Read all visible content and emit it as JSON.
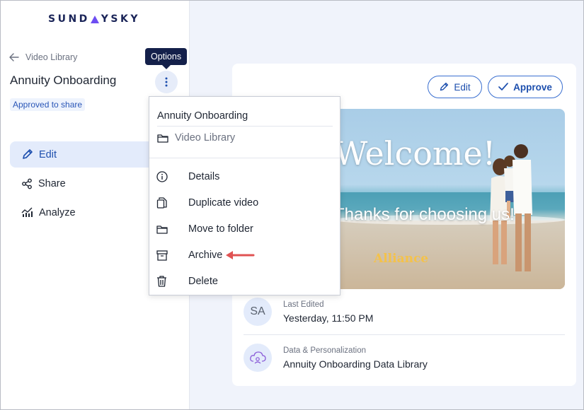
{
  "brand": {
    "logo_text_before": "SUND",
    "logo_text_after": "YSKY"
  },
  "sidebar": {
    "back_label": "Video Library",
    "video_title": "Annuity Onboarding",
    "tooltip": "Options",
    "status_badge": "Approved to share",
    "nav": [
      {
        "label": "Edit",
        "icon": "pencil-icon",
        "active": true
      },
      {
        "label": "Share",
        "icon": "share-icon",
        "active": false
      },
      {
        "label": "Analyze",
        "icon": "analyze-chart-icon",
        "active": false
      }
    ]
  },
  "menu": {
    "title": "Annuity Onboarding",
    "folder": "Video Library",
    "items": [
      {
        "label": "Details",
        "icon": "info-icon"
      },
      {
        "label": "Duplicate video",
        "icon": "duplicate-icon"
      },
      {
        "label": "Move to folder",
        "icon": "folder-icon"
      },
      {
        "label": "Archive",
        "icon": "archive-icon"
      },
      {
        "label": "Delete",
        "icon": "trash-icon"
      }
    ]
  },
  "main": {
    "edit_button": "Edit",
    "approve_button": "Approve",
    "thumbnail": {
      "headline": "Welcome!",
      "subline": "Thanks for choosing us!",
      "brand": "Alliance"
    },
    "last_edited": {
      "avatar": "SA",
      "label": "Last Edited",
      "value": "Yesterday, 11:50 PM"
    },
    "data_library": {
      "label": "Data & Personalization",
      "value": "Annuity Onboarding Data Library"
    }
  },
  "colors": {
    "accent": "#1d4fae",
    "tooltip_bg": "#14204a",
    "annotation_arrow": "#e05353"
  }
}
